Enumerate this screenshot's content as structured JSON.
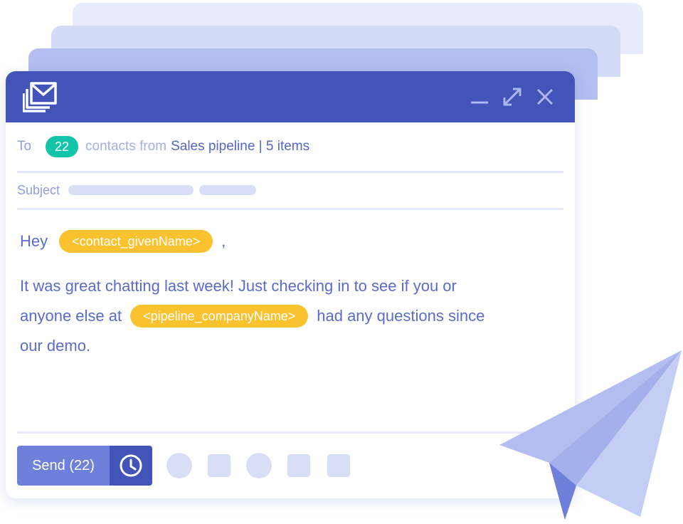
{
  "window": {
    "icons": {
      "mail": "mail-stack-icon",
      "minimize": "minimize-icon",
      "maximize": "expand-icon",
      "close": "close-icon"
    }
  },
  "recipients": {
    "label": "To",
    "count": "22",
    "text": "contacts from",
    "source": "Sales pipeline | 5 items"
  },
  "subject": {
    "label": "Subject"
  },
  "message": {
    "greeting": "Hey",
    "name_token": "<contact_givenName>",
    "comma": ",",
    "line1": "It was great chatting last week!  Just checking in to see if you or",
    "line2_before": "anyone else at",
    "company_token": "<pipeline_companyName>",
    "line2_after": "had any questions since",
    "line3": "our demo."
  },
  "footer": {
    "send_label": "Send (22)",
    "schedule_icon": "clock-icon"
  },
  "colors": {
    "header": "#4354b8",
    "accent": "#5a6bcc",
    "badge": "#14c4a8",
    "token": "#f9c22e"
  }
}
